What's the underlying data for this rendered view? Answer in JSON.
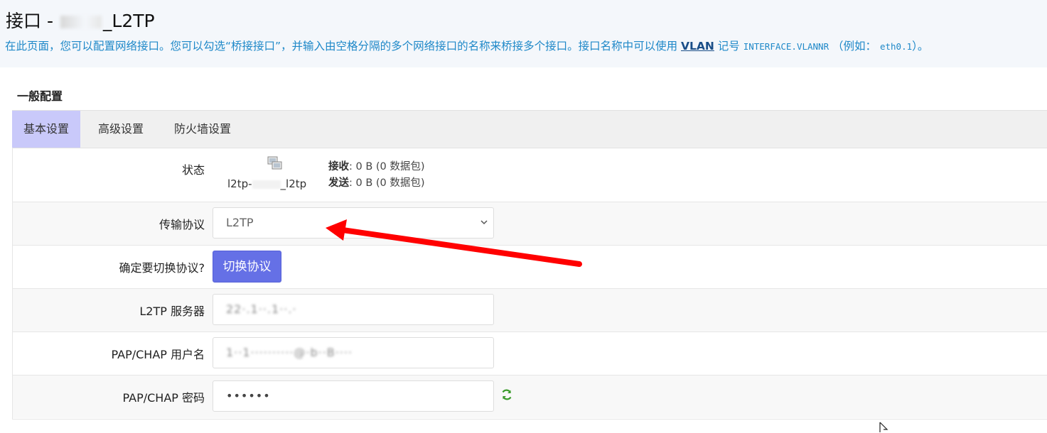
{
  "header": {
    "title_prefix": "接口 - ",
    "title_hidden_part": "23",
    "title_suffix": "_L2TP",
    "description_part1": "在此页面，您可以配置网络接口。您可以勾选“桥接接口”，并输入由空格分隔的多个网络接口的名称来桥接多个接口。接口名称中可以使用 ",
    "description_link": "VLAN",
    "description_part2": " 记号 ",
    "description_code": "INTERFACE.VLANNR",
    "description_part3": " （例如： ",
    "description_example": "eth0.1",
    "description_part4": "）。"
  },
  "section": {
    "title": "一般配置"
  },
  "tabs": [
    {
      "label": "基本设置",
      "active": true
    },
    {
      "label": "高级设置",
      "active": false
    },
    {
      "label": "防火墙设置",
      "active": false
    }
  ],
  "form": {
    "status": {
      "label": "状态",
      "ifname_prefix": "l2tp-",
      "ifname_suffix": "_l2tp",
      "rx_label": "接收",
      "rx_value": ": 0 B (0 数据包)",
      "tx_label": "发送",
      "tx_value": ": 0 B (0 数据包)"
    },
    "protocol": {
      "label": "传输协议",
      "value": "L2TP"
    },
    "switch": {
      "label": "确定要切换协议?",
      "button": "切换协议"
    },
    "server": {
      "label": "L2TP 服务器",
      "value": "22·.1··.1··.·"
    },
    "username": {
      "label": "PAP/CHAP 用户名",
      "value": "1··1··········@·b··B····"
    },
    "password": {
      "label": "PAP/CHAP 密码",
      "value": "••••••"
    }
  },
  "colors": {
    "accent": "#6570e6",
    "active_tab": "#c9c9fa",
    "description": "#1e88c8",
    "annotation_arrow": "#ff0000"
  }
}
